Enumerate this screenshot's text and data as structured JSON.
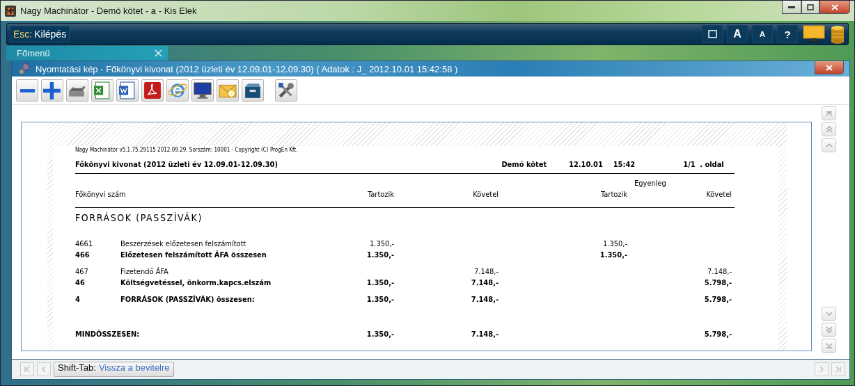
{
  "window": {
    "title": "Nagy Machinátor - Demó kötet - a - Kis Elek"
  },
  "command_bar": {
    "key": "Esc:",
    "label": "Kilépés",
    "tools": [
      "A",
      "A",
      "?"
    ]
  },
  "tabs": [
    {
      "label": "Főmenü",
      "selected": true
    }
  ],
  "print_window": {
    "title": "Nyomtatási kép - Főkönyvi kivonat (2012 üzleti év 12.09.01-12.09.30) ( Adatok : J_ 2012.10.01 15:42:58 )"
  },
  "report": {
    "meta": "Nagy Machinátor v5.1.75.29115 2012.09.29. Sorszám: 10001 - Copyright (C) ProgEn Kft.",
    "title": "Főkönyvi kivonat (2012 üzleti év 12.09.01-12.09.30)",
    "volume": "Demó kötet",
    "date": "12.10.01",
    "time": "15:42",
    "page": "1/1",
    "page_suffix": ". oldal",
    "balance_heading": "Egyenleg",
    "columns": [
      "Főkönyvi szám",
      "Tartozik",
      "Követel",
      "Tartozik",
      "Követel"
    ],
    "section": "FORRÁSOK (PASSZÍVÁK)",
    "groups": [
      {
        "rows": [
          {
            "code": "4661",
            "name": "Beszerzések előzetesen felszámított",
            "debit": "1.350,-",
            "balance_debit": "1.350,-",
            "bold": false
          },
          {
            "code": "466",
            "name": "Előzetesen felszámított ÁFA összesen",
            "debit": "1.350,-",
            "balance_debit": "1.350,-",
            "bold": true
          }
        ]
      },
      {
        "rows": [
          {
            "code": "467",
            "name": "Fizetendő ÁFA",
            "credit": "7.148,-",
            "balance_credit": "7.148,-",
            "bold": false
          },
          {
            "code": "46",
            "name": "Költségvetéssel, önkorm.kapcs.elszám",
            "debit": "1.350,-",
            "credit": "7.148,-",
            "balance_credit": "5.798,-",
            "bold": true
          }
        ]
      },
      {
        "rows": [
          {
            "code": "4",
            "name": "FORRÁSOK (PASSZÍVÁK) összesen:",
            "debit": "1.350,-",
            "credit": "7.148,-",
            "balance_credit": "5.798,-",
            "bold": true
          }
        ]
      }
    ],
    "total": {
      "label": "MINDÖSSZESEN:",
      "debit": "1.350,-",
      "credit": "7.148,-",
      "balance_credit": "5.798,-"
    }
  },
  "footer": {
    "key": "Shift-Tab:",
    "label": "Vissza a bevitelre"
  }
}
